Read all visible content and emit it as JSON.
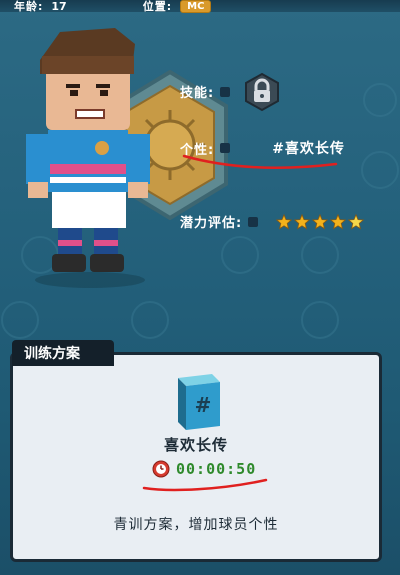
{
  "header": {
    "age_label": "年龄:",
    "age_value": "17",
    "position_label": "位置:",
    "position_value": "MC"
  },
  "player_info": {
    "skill_label": "技能:",
    "skill_icon": "lock-icon",
    "personality_label": "个性:",
    "personality_value": "#喜欢长传",
    "potential_label": "潜力评估:",
    "potential_stars": 4.5
  },
  "training": {
    "tab_label": "训练方案",
    "plan_icon": "book-icon",
    "plan_name": "喜欢长传",
    "timer_icon": "clock-icon",
    "timer_value": "00:00:50",
    "description": "青训方案，增加球员个性"
  },
  "colors": {
    "star": "#f3b21c",
    "timer_text": "#2f8a2c",
    "annotation": "#e0201f"
  }
}
